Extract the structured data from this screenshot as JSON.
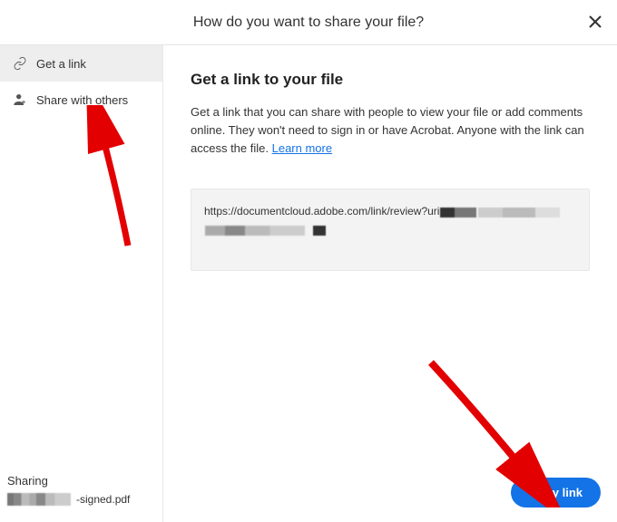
{
  "header": {
    "title": "How do you want to share your file?"
  },
  "sidebar": {
    "items": [
      {
        "label": "Get a link"
      },
      {
        "label": "Share with others"
      }
    ],
    "footer": {
      "label": "Sharing",
      "file_suffix": "-signed.pdf"
    }
  },
  "main": {
    "title": "Get a link to your file",
    "desc_before": "Get a link that you can share with people to view your file or add comments online. They won't need to sign in or have Acrobat. Anyone with the link can access the file. ",
    "learn_more": "Learn more",
    "link_url_prefix": "https://documentcloud.adobe.com/link/review?uri",
    "copy_button": "Copy link"
  }
}
